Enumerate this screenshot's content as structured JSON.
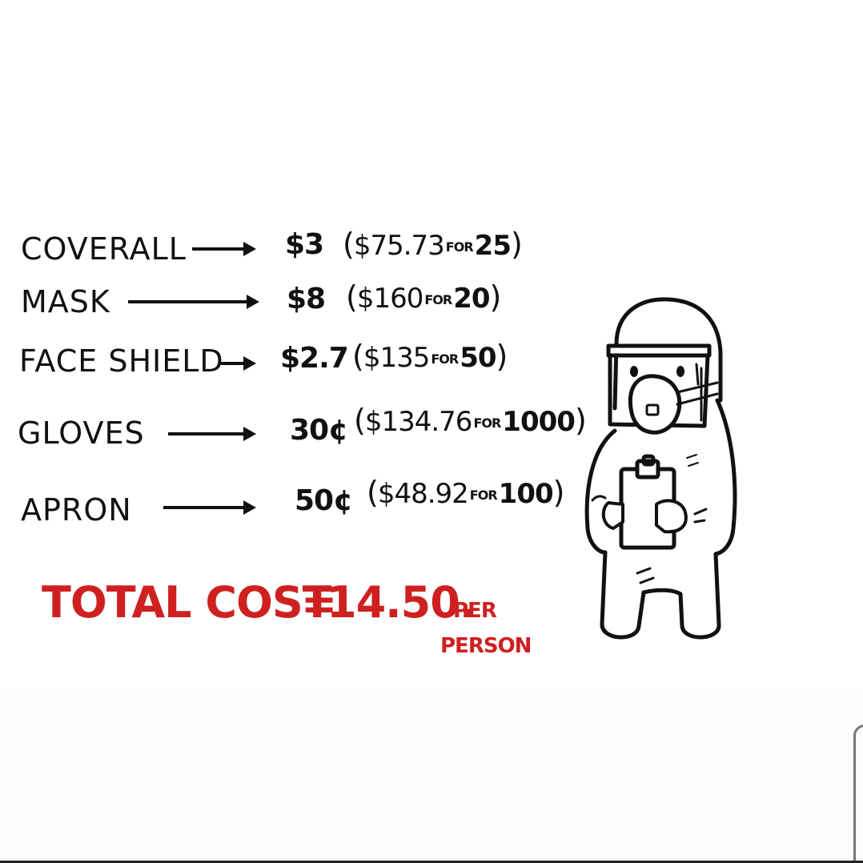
{
  "items": [
    {
      "name": "COVERALL",
      "price": "$3",
      "bulk_price": "$75.73",
      "bulk_for": "FOR",
      "bulk_qty": "25"
    },
    {
      "name": "MASK",
      "price": "$8",
      "bulk_price": "$160",
      "bulk_for": "FOR",
      "bulk_qty": "20"
    },
    {
      "name": "FACE SHIELD",
      "price": "$2.7",
      "bulk_price": "$135",
      "bulk_for": "FOR",
      "bulk_qty": "50"
    },
    {
      "name": "GLOVES",
      "price": "30¢",
      "bulk_price": "$134.76",
      "bulk_for": "FOR",
      "bulk_qty": "1000"
    },
    {
      "name": "APRON",
      "price": "50¢",
      "bulk_price": "$48.92",
      "bulk_for": "FOR",
      "bulk_qty": "100"
    }
  ],
  "total": {
    "label": "TOTAL COST",
    "equals": "=",
    "value": "14.50.",
    "per": "PER",
    "person": "PERSON"
  },
  "colors": {
    "ink": "#111111",
    "total_red": "#cf2020",
    "background": "#ffffff"
  },
  "illustration": "person-in-ppe-holding-clipboard"
}
